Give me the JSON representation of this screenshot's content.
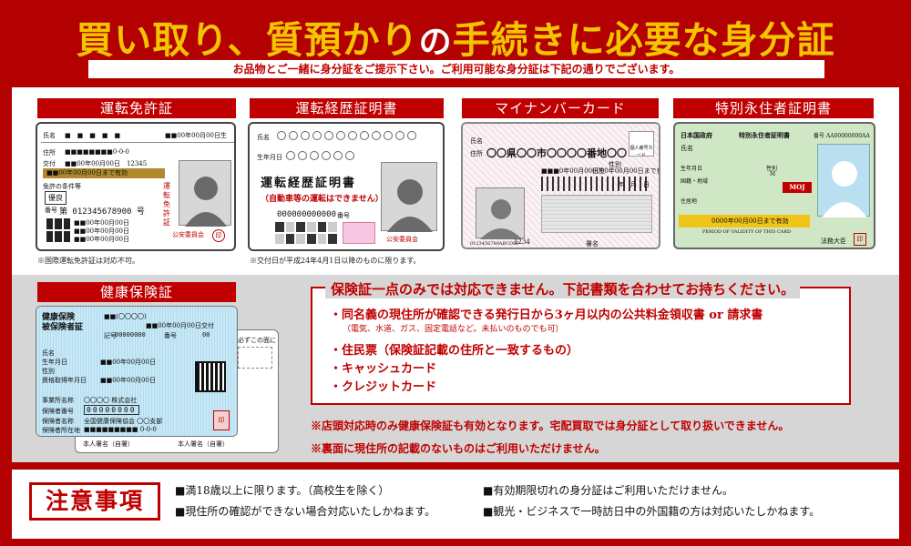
{
  "header": {
    "title_part1": "買い取り、質預かり",
    "title_part2": "の",
    "title_part3": "手続きに必要な身分証",
    "subtitle": "お品物とご一緒に身分証をご提示下さい。ご利用可能な身分証は下記の通りでございます。"
  },
  "cards": {
    "license": {
      "label": "運転免許証",
      "name_row": "氏名",
      "name_blocks": "■　■　■　■　■",
      "birth_date": "■■00年00月00日生",
      "address_label": "住所",
      "address_value": "■■■■■■■■0-0-0",
      "issue_label": "交付",
      "issue_value": "■■00年00月00日　12345",
      "expiry": "■■00年00月00日まで有効",
      "condition_label": "免許の条件等",
      "gold_label": "優良",
      "number_label": "番号",
      "number_value": "第 012345678900 号",
      "kind_label": "運転免許証",
      "commission": "公安委員会",
      "seal": "印",
      "dates": [
        "■■00年00月00日",
        "■■00年00月00日",
        "■■00年00月00日"
      ],
      "note": "※国際運転免許証は対応不可。"
    },
    "history": {
      "label": "運転経歴証明書",
      "name_label": "氏名",
      "birth_label": "生年月日",
      "big_title": "運転経歴証明書",
      "sub_title": "（自動車等の運転はできません）",
      "number_label": "番号",
      "number_value": "000000000000",
      "commission": "公安委員会",
      "note": "※交付日が平成24年4月1日以降のものに限ります。"
    },
    "mynumber": {
      "label": "マイナンバーカード",
      "name_label": "氏名",
      "address_label": "住所",
      "address_value": "〇〇県〇〇市〇〇〇〇番地〇〇",
      "birth_value": "■■■0年00月00日生",
      "expiry_value": "0000年00月00日まで有効",
      "sex_label": "性別",
      "year_month_day": "年　月　日",
      "badge": "個人番号カード",
      "serial": "0123456789ABCDEF",
      "code": "1234",
      "footer": "署名"
    },
    "residence": {
      "label": "特別永住者証明書",
      "gov": "日本国政府",
      "title": "特別永住者証明書",
      "number": "番号 AA00000000AA",
      "name_label": "氏名",
      "birth_label": "生年月日",
      "sex_label": "性別",
      "sex_value": "M",
      "nationality_label": "国籍・地域",
      "address_label": "住居地",
      "expiry_value": "0000年00月00日まで有効",
      "period_label": "PERIOD OF VALIDITY OF THIS CARD",
      "minister": "法務大臣",
      "seal": "印",
      "moj": "MOJ"
    },
    "insurance": {
      "label": "健康保険証",
      "line1": "健康保険",
      "line2": "被保険者証",
      "top_right": "■■(〇〇〇〇)",
      "issue_date": "■■00年00月00日交付",
      "sign_label": "記号",
      "sign_value": "00000000",
      "number_label": "番号",
      "number_value": "00",
      "name_label": "氏名",
      "birth_label": "生年月日",
      "birth_value": "■■00年00月00日",
      "sex_label": "性別",
      "date_label": "資格取得年月日",
      "date_value": "■■00年00月00日",
      "employer_label": "事業所名称",
      "employer_value": "〇〇〇〇 株式会社",
      "insurer_num_label": "保険者番号",
      "insurer_num_value": "00000000",
      "insurer_name_label": "保険者名称",
      "insurer_name_value": "全国健康保険協会 〇〇支部",
      "insurer_addr_label": "保険者所在地",
      "insurer_addr_value": "■■■■■■■■■ 0-0-0",
      "seal": "印",
      "back_line1": "必ずこの面に",
      "back_sign": "本人署名（自署）",
      "back_footer": "本人署名（自署）"
    }
  },
  "warning": {
    "head": "保険証一点のみでは対応できません。下記書類を合わせてお持ちください。",
    "items": [
      "・同名義の現住所が確認できる発行日から3ヶ月以内の公共料金領収書 or 請求書",
      "・住民票（保険証記載の住所と一致するもの）",
      "・キャッシュカード",
      "・クレジットカード"
    ],
    "sub": "（電気、水道、ガス、固定電話など。未払いのものでも可）",
    "note1": "※店頭対応時のみ健康保険証も有効となります。宅配買取では身分証として取り扱いできません。",
    "note2": "※裏面に現住所の記載のないものはご利用いただけません。"
  },
  "caution": {
    "title": "注意事項",
    "items": [
      "■満18歳以上に限ります。（高校生を除く）",
      "■現住所の確認ができない場合対応いたしかねます。",
      "■有効期限切れの身分証はご利用いただけません。",
      "■観光・ビジネスで一時訪日中の外国籍の方は対応いたしかねます。"
    ]
  },
  "colors": {
    "brand_red": "#b30000",
    "accent_red": "#c00000",
    "title_yellow": "#f3c400",
    "panel_gray": "#d6d6d6"
  }
}
